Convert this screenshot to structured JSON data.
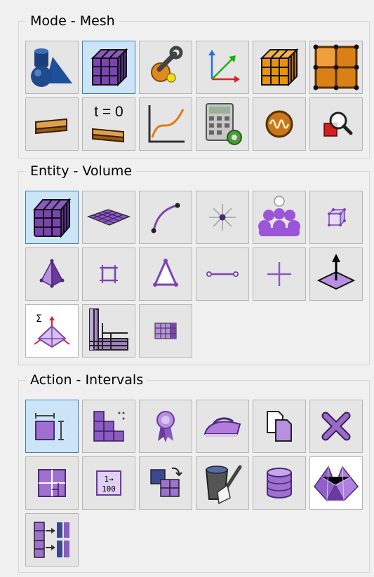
{
  "mode_group": {
    "title": "Mode - Mesh",
    "buttons": [
      {
        "icon": "geometry-icon",
        "selected": false
      },
      {
        "icon": "mesh-icon",
        "selected": true
      },
      {
        "icon": "tools-icon",
        "selected": false
      },
      {
        "icon": "coordinate-axes-icon",
        "selected": false
      },
      {
        "icon": "orange-mesh-cube-icon",
        "selected": false
      },
      {
        "icon": "grid-nodes-icon",
        "selected": false
      },
      {
        "icon": "surface-strip-icon",
        "selected": false
      },
      {
        "icon": "time-zero-icon",
        "selected": false,
        "label": "t = 0"
      },
      {
        "icon": "curve-plot-icon",
        "selected": false
      },
      {
        "icon": "calculator-gear-icon",
        "selected": false
      },
      {
        "icon": "signal-wave-icon",
        "selected": false
      },
      {
        "icon": "zoom-select-icon",
        "selected": false
      }
    ]
  },
  "entity_group": {
    "title": "Entity - Volume",
    "buttons": [
      {
        "icon": "volume-icon",
        "selected": true
      },
      {
        "icon": "surface-icon",
        "selected": false
      },
      {
        "icon": "curve-icon",
        "selected": false
      },
      {
        "icon": "vertex-icon",
        "selected": false
      },
      {
        "icon": "group-icon",
        "selected": false
      },
      {
        "icon": "hex-element-icon",
        "selected": false
      },
      {
        "icon": "tet-element-icon",
        "selected": false
      },
      {
        "icon": "quad-element-icon",
        "selected": false
      },
      {
        "icon": "tri-element-icon",
        "selected": false
      },
      {
        "icon": "edge-element-icon",
        "selected": false
      },
      {
        "icon": "node-element-icon",
        "selected": false
      },
      {
        "icon": "surface-normal-icon",
        "selected": false
      },
      {
        "icon": "sum-constraint-icon",
        "selected": false
      },
      {
        "icon": "structured-block-icon",
        "selected": false
      },
      {
        "icon": "block-grid-icon",
        "selected": false
      }
    ]
  },
  "action_group": {
    "title": "Action - Intervals",
    "buttons": [
      {
        "icon": "intervals-icon",
        "selected": true
      },
      {
        "icon": "mesh-scheme-icon",
        "selected": false
      },
      {
        "icon": "quality-ribbon-icon",
        "selected": false
      },
      {
        "icon": "smooth-iron-icon",
        "selected": false
      },
      {
        "icon": "copy-mesh-icon",
        "selected": false
      },
      {
        "icon": "delete-mesh-icon",
        "selected": false
      },
      {
        "icon": "refine-mesh-icon",
        "selected": false
      },
      {
        "icon": "renumber-icon",
        "selected": false,
        "label_top": "1→",
        "label_bottom": "100"
      },
      {
        "icon": "swap-mesh-icon",
        "selected": false
      },
      {
        "icon": "clean-brush-icon",
        "selected": false
      },
      {
        "icon": "database-icon",
        "selected": false
      },
      {
        "icon": "sweep-mesh-icon",
        "selected": false
      },
      {
        "icon": "propagate-icon",
        "selected": false
      }
    ]
  }
}
